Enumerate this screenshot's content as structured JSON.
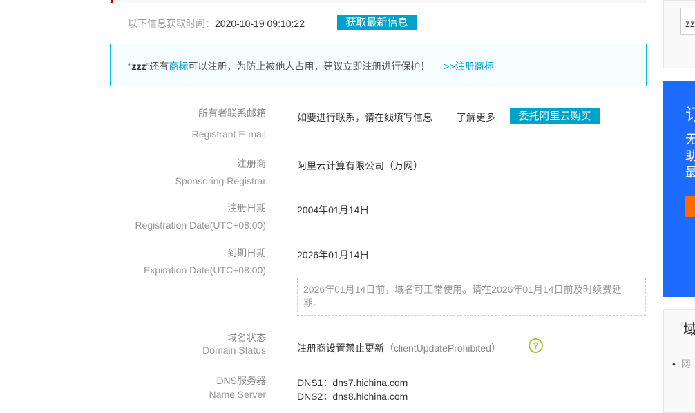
{
  "header": {
    "fetch_label": "以下信息获取时间：",
    "fetch_time": "2020-10-19 09:10:22",
    "refresh_button": "获取最新信息"
  },
  "notice": {
    "q1": "“",
    "domain": "zzz",
    "q2": "”还有",
    "link": "商标",
    "text": "可以注册，为防止被他人占用，建议立即注册进行保护！",
    "register_link": ">>注册商标"
  },
  "rows": [
    {
      "cn": "所有者联系邮箱",
      "en": "Registrant E-mail",
      "link1": "如要进行联系，请在线填写信息",
      "link2": "了解更多",
      "button": "委托阿里云购买"
    },
    {
      "cn": "注册商",
      "en": "Sponsoring Registrar",
      "value": "阿里云计算有限公司（万网）"
    },
    {
      "cn": "注册日期",
      "en": "Registration Date(UTC+08:00)",
      "value": "2004年01月14日"
    },
    {
      "cn": "到期日期",
      "en": "Expiration Date(UTC+08:00)",
      "value": "2026年01月14日",
      "tip": "2026年01月14日前，域名可正常使用。请在2026年01月14日前及时续费延期。"
    },
    {
      "cn": "域名状态",
      "en": "Domain Status",
      "value": "注册商设置禁止更新",
      "value_en": "（clientUpdateProhibited）"
    },
    {
      "cn": "DNS服务器",
      "en": "Name Server",
      "dns1": "DNS1：dns7.hichina.com",
      "dns2": "DNS2：dns8.hichina.com"
    }
  ],
  "sidebar": {
    "search_value": "zzz",
    "promo_title": "订",
    "promo_desc": "无助最",
    "panel_title": "域",
    "list_item": "网"
  },
  "colors": {
    "accent": "#00a2ca",
    "promo": "#1e6bff",
    "orange": "#ff6a00",
    "help": "#99cc33"
  }
}
